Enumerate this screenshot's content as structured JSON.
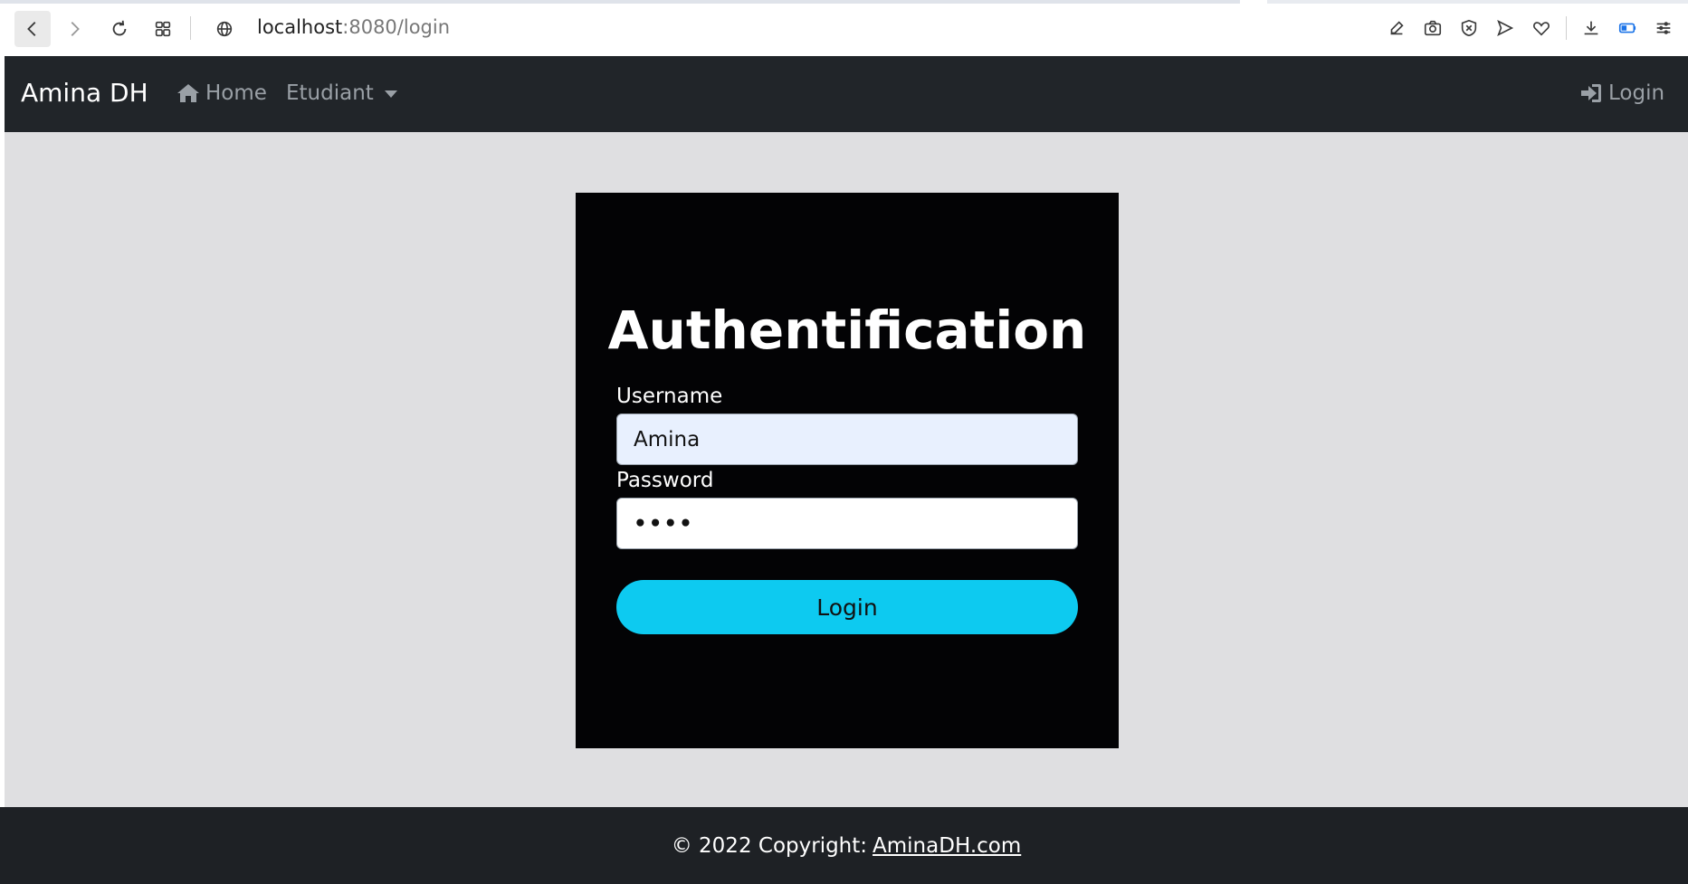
{
  "browser": {
    "url_host": "localhost",
    "url_path": ":8080/login"
  },
  "navbar": {
    "brand": "Amina DH",
    "home_label": "Home",
    "etudiant_label": "Etudiant",
    "login_label": "Login"
  },
  "form": {
    "title": "Authentification",
    "username_label": "Username",
    "username_value": "Amina",
    "password_label": "Password",
    "password_value": "••••",
    "login_button": "Login"
  },
  "footer": {
    "copyright": "© 2022 Copyright:",
    "link": "AminaDH.com"
  },
  "colors": {
    "navbar_bg": "#212529",
    "page_bg": "#dfdfe1",
    "card_bg": "#030305",
    "button": "#0dcaf0",
    "autofill": "#e8f0fe"
  },
  "icons": [
    "back-icon",
    "forward-icon",
    "reload-icon",
    "tabs-grid-icon",
    "globe-icon",
    "edit-icon",
    "camera-icon",
    "shield-icon",
    "send-icon",
    "heart-icon",
    "download-icon",
    "battery-icon",
    "menu-icon",
    "home-icon",
    "sign-in-icon"
  ]
}
